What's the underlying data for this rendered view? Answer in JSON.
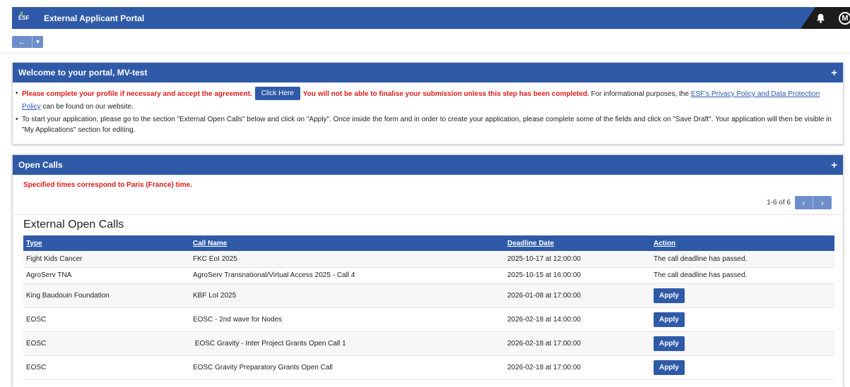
{
  "topbar": {
    "logo_text": "ESF",
    "app_title": "External Applicant Portal",
    "avatar_letter": "M",
    "icons": [
      "bell-icon",
      "avatar"
    ]
  },
  "nav": {
    "back_icon": "←",
    "dropdown_icon": "▼"
  },
  "welcome": {
    "title": "Welcome to your portal, MV-test",
    "expand_icon": "+",
    "bullet1_red_a": "Please complete your profile if necessary and accept the agreement.",
    "click_here": "Click Here",
    "bullet1_red_b": "You will not be able to finalise your submission unless this step has been completed.",
    "bullet1_text_a": "For informational purposes, the",
    "bullet1_link": "ESF's Privacy Policy and Data Protection Policy",
    "bullet1_text_b": "can be found on our website.",
    "bullet2": "To start your application, please go to the section \"External Open Calls\" below and click on \"Apply\". Once inside the form and in order to create your application, please complete some of the fields and click on \"Save Draft\". Your application will then be visible in \"My Applications\" section for editing."
  },
  "open_calls": {
    "title": "Open Calls",
    "expand_icon": "+",
    "note": "Specified times correspond to Paris (France) time.",
    "pager_count": "1-6 of 6",
    "prev_icon": "‹",
    "next_icon": "›",
    "table_title": "External Open Calls",
    "columns": {
      "type": "Type",
      "call_name": "Call Name",
      "deadline": "Deadline Date",
      "action": "Action"
    },
    "rows": [
      {
        "type": "Fight Kids Cancer",
        "call_name": "FKC EoI 2025",
        "deadline": "2025-10-17 at 12:00:00",
        "action": "The call deadline has passed."
      },
      {
        "type": "AgroServ TNA",
        "call_name": "AgroServ Transnational/Virtual Access 2025 - Call 4",
        "deadline": "2025-10-15 at 16:00:00",
        "action": "The call deadline has passed."
      },
      {
        "type": "King Baudouin Foundation",
        "call_name": "KBF LoI 2025",
        "deadline": "2026-01-08 at 17:00:00",
        "action": "Apply"
      },
      {
        "type": "EOSC",
        "call_name": "EOSC - 2nd wave for Nodes",
        "deadline": "2026-02-18 at 14:00:00",
        "action": "Apply"
      },
      {
        "type": "EOSC",
        "call_name": " EOSC Gravity - Inter Project Grants Open Call 1",
        "deadline": "2026-02-18 at 17:00:00",
        "action": "Apply"
      },
      {
        "type": "EOSC",
        "call_name": "EOSC Gravity Preparatory Grants Open Call",
        "deadline": "2026-02-18 at 17:00:00",
        "action": "Apply"
      }
    ]
  }
}
